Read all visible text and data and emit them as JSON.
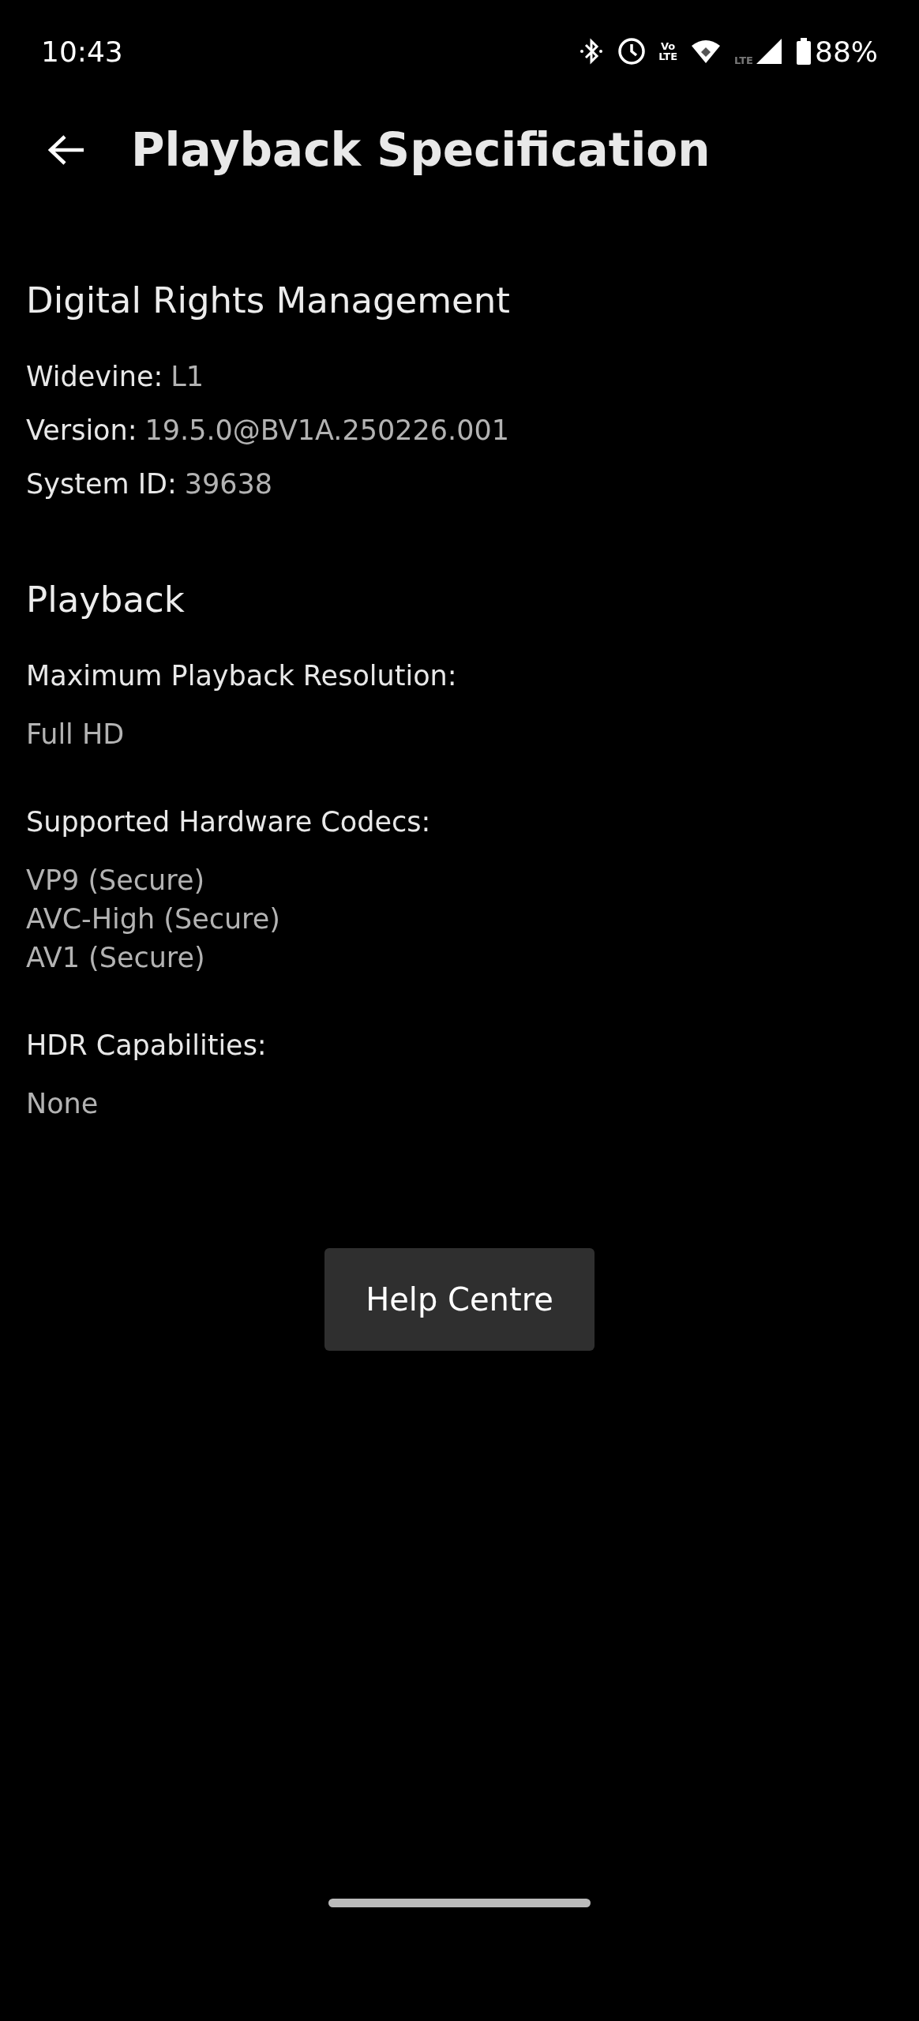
{
  "status_bar": {
    "time": "10:43",
    "volte": [
      "Vo",
      "LTE"
    ],
    "network": "LTE",
    "battery": "88%"
  },
  "header": {
    "title": "Playback Specification"
  },
  "sections": [
    {
      "heading": "Digital Rights Management",
      "kind": "inline",
      "items": [
        {
          "label": "Widevine:",
          "values": [
            "L1"
          ]
        },
        {
          "label": "Version:",
          "values": [
            "19.5.0@BV1A.250226.001"
          ]
        },
        {
          "label": "System ID:",
          "values": [
            "39638"
          ]
        }
      ]
    },
    {
      "heading": "Playback",
      "kind": "stacked",
      "items": [
        {
          "label": "Maximum Playback Resolution:",
          "values": [
            "Full HD"
          ]
        },
        {
          "label": "Supported Hardware Codecs:",
          "values": [
            "VP9 (Secure)",
            "AVC-High (Secure)",
            "AV1 (Secure)"
          ]
        },
        {
          "label": "HDR Capabilities:",
          "values": [
            "None"
          ]
        }
      ]
    }
  ],
  "help_button": {
    "label": "Help Centre"
  }
}
